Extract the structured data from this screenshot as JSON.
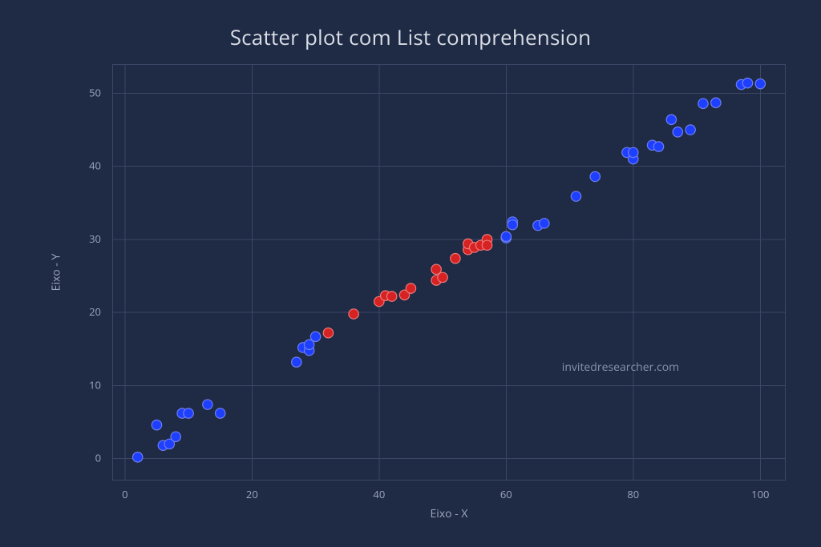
{
  "chart_data": {
    "type": "scatter",
    "title": "Scatter plot com List comprehension",
    "xlabel": "Eixo - X",
    "ylabel": "Eixo - Y",
    "xlim": [
      -2,
      104
    ],
    "ylim": [
      -3,
      54
    ],
    "xticks": [
      0,
      20,
      40,
      60,
      80,
      100
    ],
    "yticks": [
      0,
      10,
      20,
      30,
      40,
      50
    ],
    "series": [
      {
        "name": "blue",
        "color": "#1f3fff",
        "points": [
          {
            "x": 2,
            "y": 0.2
          },
          {
            "x": 5,
            "y": 4.6
          },
          {
            "x": 6,
            "y": 1.8
          },
          {
            "x": 7,
            "y": 2.0
          },
          {
            "x": 8,
            "y": 3.0
          },
          {
            "x": 9,
            "y": 6.2
          },
          {
            "x": 10,
            "y": 6.2
          },
          {
            "x": 13,
            "y": 7.4
          },
          {
            "x": 15,
            "y": 6.2
          },
          {
            "x": 27,
            "y": 13.2
          },
          {
            "x": 28,
            "y": 15.2
          },
          {
            "x": 29,
            "y": 14.8
          },
          {
            "x": 29,
            "y": 15.6
          },
          {
            "x": 30,
            "y": 16.7
          },
          {
            "x": 60,
            "y": 30.2
          },
          {
            "x": 60,
            "y": 30.4
          },
          {
            "x": 61,
            "y": 32.4
          },
          {
            "x": 61,
            "y": 32.0
          },
          {
            "x": 65,
            "y": 31.9
          },
          {
            "x": 66,
            "y": 32.2
          },
          {
            "x": 71,
            "y": 35.9
          },
          {
            "x": 74,
            "y": 38.6
          },
          {
            "x": 79,
            "y": 41.9
          },
          {
            "x": 80,
            "y": 41.0
          },
          {
            "x": 80,
            "y": 41.9
          },
          {
            "x": 83,
            "y": 42.9
          },
          {
            "x": 84,
            "y": 42.7
          },
          {
            "x": 86,
            "y": 46.4
          },
          {
            "x": 87,
            "y": 44.7
          },
          {
            "x": 89,
            "y": 45.0
          },
          {
            "x": 91,
            "y": 48.6
          },
          {
            "x": 93,
            "y": 48.7
          },
          {
            "x": 97,
            "y": 51.2
          },
          {
            "x": 98,
            "y": 51.4
          },
          {
            "x": 100,
            "y": 51.3
          }
        ]
      },
      {
        "name": "red",
        "color": "#d62222",
        "points": [
          {
            "x": 32,
            "y": 17.2
          },
          {
            "x": 36,
            "y": 19.8
          },
          {
            "x": 40,
            "y": 21.5
          },
          {
            "x": 41,
            "y": 22.3
          },
          {
            "x": 42,
            "y": 22.2
          },
          {
            "x": 44,
            "y": 22.4
          },
          {
            "x": 45,
            "y": 23.3
          },
          {
            "x": 49,
            "y": 25.9
          },
          {
            "x": 49,
            "y": 24.4
          },
          {
            "x": 50,
            "y": 24.8
          },
          {
            "x": 52,
            "y": 27.4
          },
          {
            "x": 54,
            "y": 28.6
          },
          {
            "x": 54,
            "y": 29.4
          },
          {
            "x": 55,
            "y": 28.9
          },
          {
            "x": 56,
            "y": 29.2
          },
          {
            "x": 57,
            "y": 30.0
          },
          {
            "x": 57,
            "y": 29.2
          }
        ]
      }
    ],
    "annotation": {
      "text": "invitedresearcher.com",
      "x": 78,
      "y": 12
    }
  }
}
